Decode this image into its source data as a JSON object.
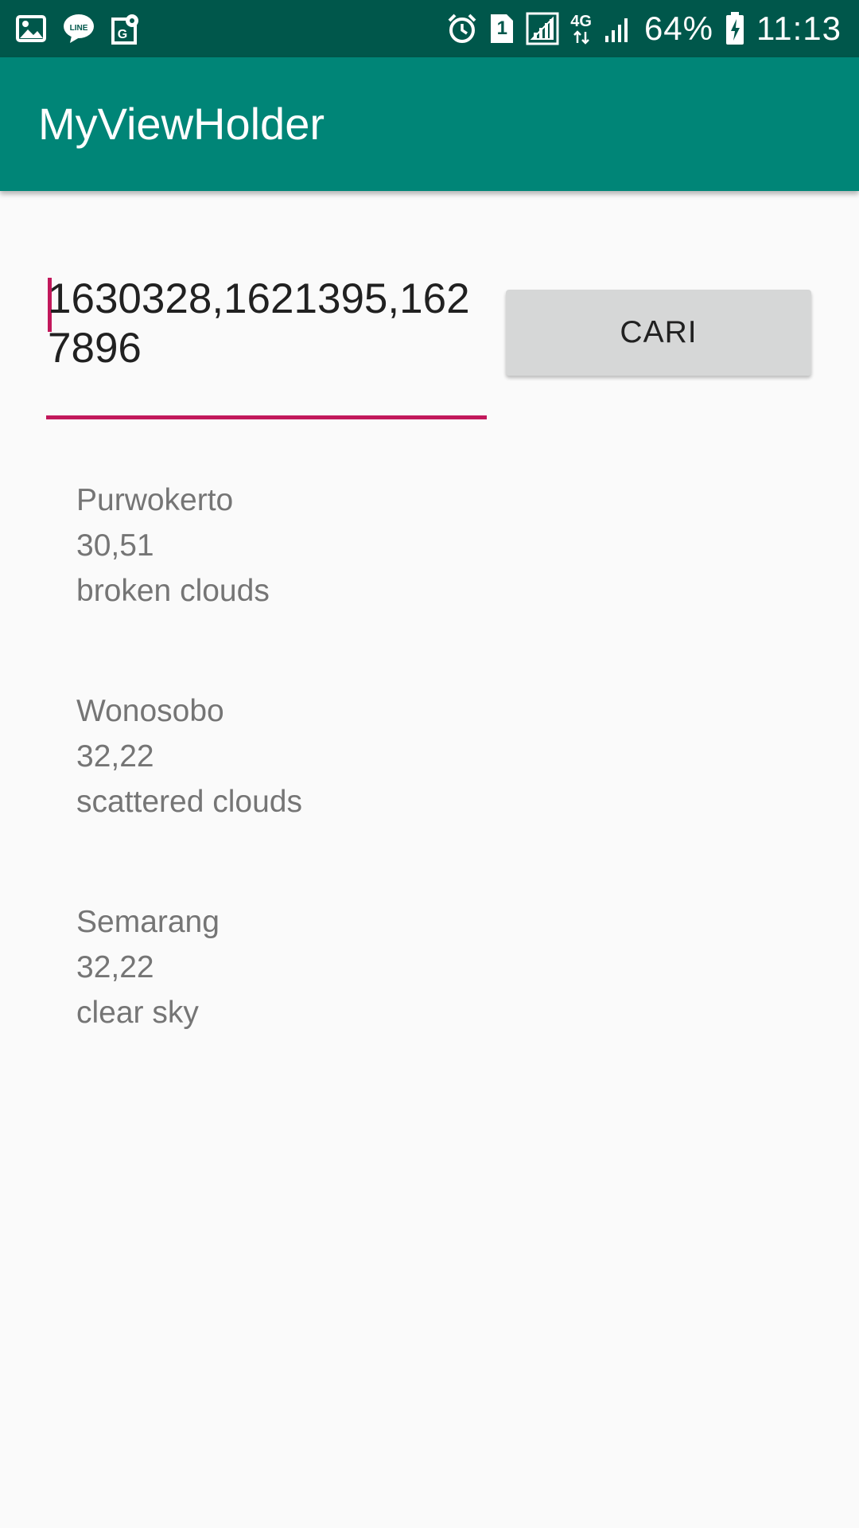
{
  "status_bar": {
    "notification_icons": [
      "gallery-icon",
      "line-icon",
      "maps-icon"
    ],
    "system_icons": [
      "alarm-icon",
      "sim-1-icon",
      "signal-icon",
      "4g-icon",
      "signal-icon-2",
      "battery-charging-icon"
    ],
    "network_label": "4G",
    "sim_label": "1",
    "battery": "64%",
    "time": "11:13"
  },
  "app_bar": {
    "title": "MyViewHolder"
  },
  "search": {
    "value": "1630328,1621395,1627896"
  },
  "cari_button": {
    "label": "CARI"
  },
  "results": [
    {
      "city": "Purwokerto",
      "temp": "30,51",
      "desc": "broken clouds"
    },
    {
      "city": "Wonosobo",
      "temp": "32,22",
      "desc": "scattered clouds"
    },
    {
      "city": "Semarang",
      "temp": "32,22",
      "desc": "clear sky"
    }
  ],
  "colors": {
    "status_bar": "#00574b",
    "app_bar": "#008577",
    "accent": "#c2185b",
    "button": "#d6d7d7",
    "background": "#fafafa"
  }
}
